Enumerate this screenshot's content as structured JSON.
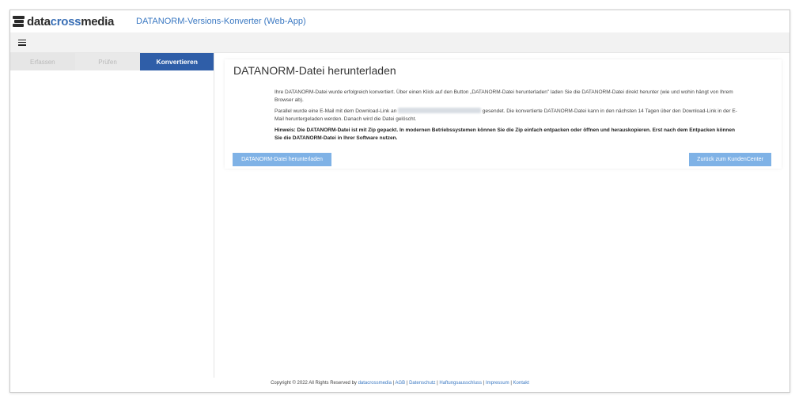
{
  "header": {
    "logo_text_dark": "data",
    "logo_text_blue": "cross",
    "logo_text_dark2": "media",
    "app_title": "DATANORM-Versions-Konverter (Web-App)"
  },
  "menu": {
    "icon": "hamburger-menu-icon"
  },
  "steps": [
    {
      "label": "Erfassen",
      "state": "done"
    },
    {
      "label": "Prüfen",
      "state": "done"
    },
    {
      "label": "Konvertieren",
      "state": "active"
    }
  ],
  "main": {
    "title": "DATANORM-Datei herunterladen",
    "p1": "Ihre DATANORM-Datei wurde erfolgreich konvertiert. Über einen Klick auf den Button „DATANORM-Datei herunterladen\" laden Sie die DATANORM-Datei direkt herunter (wie und wohin hängt von Ihrem Browser ab).",
    "p2_before": "Parallel wurde eine E-Mail mit dem Download-Link an",
    "p2_after": "gesendet. Die konvertierte DATANORM-Datei kann in den nächsten 14 Tagen über den Download-Link in der E-Mail heruntergeladen werden. Danach wird die Datei gelöscht.",
    "hint": "Hinweis: Die DATANORM-Datei ist mit Zip gepackt. In modernen Betriebssystemen können Sie die Zip einfach entpacken oder öffnen und herauskopieren. Erst nach dem Entpacken können Sie die DATANORM-Datei in Ihrer Software nutzen.",
    "download_button": "DATANORM-Datei herunterladen",
    "back_button": "Zurück zum KundenCenter"
  },
  "footer": {
    "copyright": "Copyright © 2022 All Rights Reserved by",
    "links": [
      "datacrossmedia",
      "AGB",
      "Datenschutz",
      "Haftungsausschluss",
      "Impressum",
      "Kontakt"
    ]
  },
  "colors": {
    "brand_blue": "#2f5ea8",
    "button_blue": "#7fb2e6",
    "link_blue": "#3a78c2"
  }
}
